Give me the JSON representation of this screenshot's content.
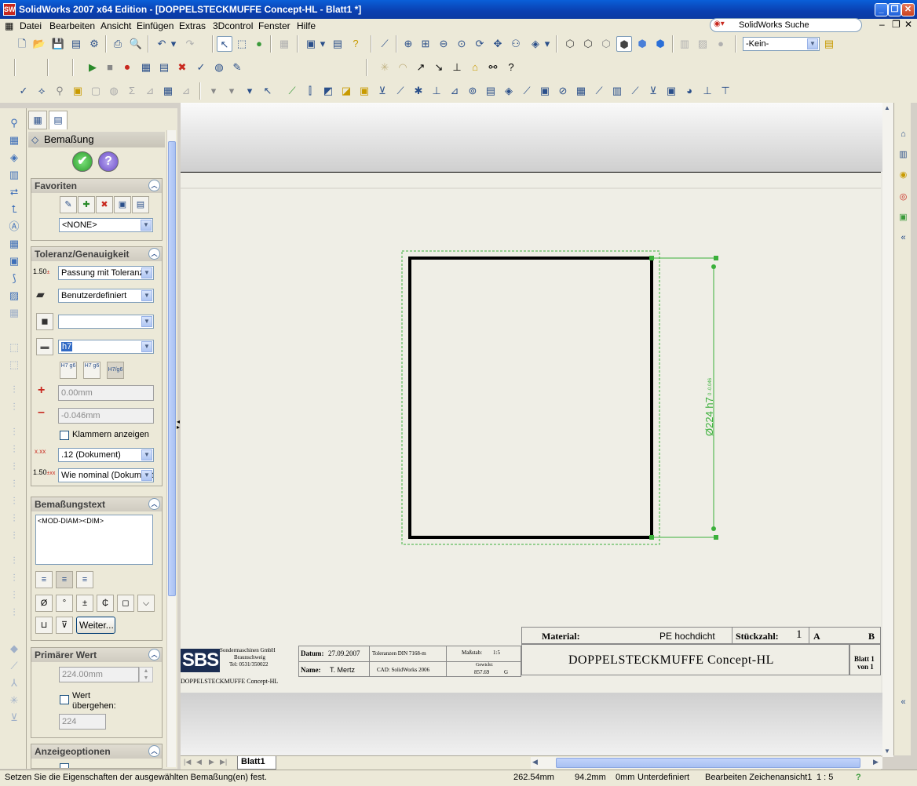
{
  "window": {
    "title": "SolidWorks 2007 x64 Edition - [DOPPELSTECKMUFFE Concept-HL - Blatt1 *]",
    "app_icon": "SW"
  },
  "menu": [
    "Datei",
    "Bearbeiten",
    "Ansicht",
    "Einfügen",
    "Extras",
    "3Dcontrol",
    "Fenster",
    "Hilfe"
  ],
  "search": {
    "placeholder": "SolidWorks Suche"
  },
  "toolbar": {
    "layer_combo": "-Kein-"
  },
  "property_manager": {
    "title": "Bemaßung",
    "ok_label": "✔",
    "help_label": "?",
    "favorites": {
      "header": "Favoriten",
      "combo_value": "<NONE>"
    },
    "tolerance": {
      "header": "Toleranz/Genauigkeit",
      "tolerance_type_icon_text": "1.50",
      "tolerance_type": "Passung mit Toleranz",
      "classification": "Benutzerdefiniert",
      "hole_fit": "",
      "shaft_fit": "h7",
      "plus_value": "0.00mm",
      "minus_value": "-0.046mm",
      "parentheses_label": "Klammern anzeigen",
      "precision_value": ".12 (Dokument)",
      "tol_precision_value": "Wie nominal (Dokument)",
      "fit_btn_1": "H7 g6",
      "fit_btn_2": "H7 g6",
      "fit_btn_3": "H7/g6"
    },
    "dimension_text": {
      "header": "Bemaßungstext",
      "text": "<MOD-DIAM><DIM>",
      "more_label": "Weiter..."
    },
    "primary_value": {
      "header": "Primärer Wert",
      "value": "224.00mm",
      "override_label": "Wert übergehen:",
      "override_value": "224"
    },
    "display_options": {
      "header": "Anzeigeoptionen"
    }
  },
  "drawing": {
    "dimension_label": "Ø224 h7",
    "dimension_tol": "0 -0.046",
    "sheet_tab": "Blatt1"
  },
  "title_block": {
    "material_label": "Material:",
    "material_value": "PE hochdicht",
    "qty_label": "Stückzahl:",
    "qty_value": "1",
    "col_a": "A",
    "col_b": "B",
    "company_logo": "SBS",
    "company_line1": "Sondermaschinen GmbH",
    "company_line2": "Braunschweig",
    "company_line3": "Tel: 0531/350022",
    "date_label": "Datum:",
    "date_value": "27.09.2007",
    "tolerances": "Toleranzen DIN 7168-m",
    "scale_label": "Maßstab:",
    "scale_value": "1:5",
    "name_label": "Name:",
    "name_value": "T. Mertz",
    "cad": "CAD: SolidWorks 2006",
    "weight_label": "Gewicht:",
    "weight_value": "857.69",
    "weight_unit": "G",
    "part_name": "DOPPELSTECKMUFFE Concept-HL",
    "sheet_label": "Blatt 1",
    "sheet_of": "von 1",
    "file_name": "DOPPELSTECKMUFFE Concept-HL"
  },
  "status": {
    "message": "Setzen Sie die Eigenschaften der ausgewählten Bemaßung(en) fest.",
    "x": "262.54mm",
    "y": "94.2mm",
    "z": "0mm",
    "state": "Unterdefiniert",
    "mode": "Bearbeiten Zeichenansicht1",
    "scale": "1 : 5"
  }
}
